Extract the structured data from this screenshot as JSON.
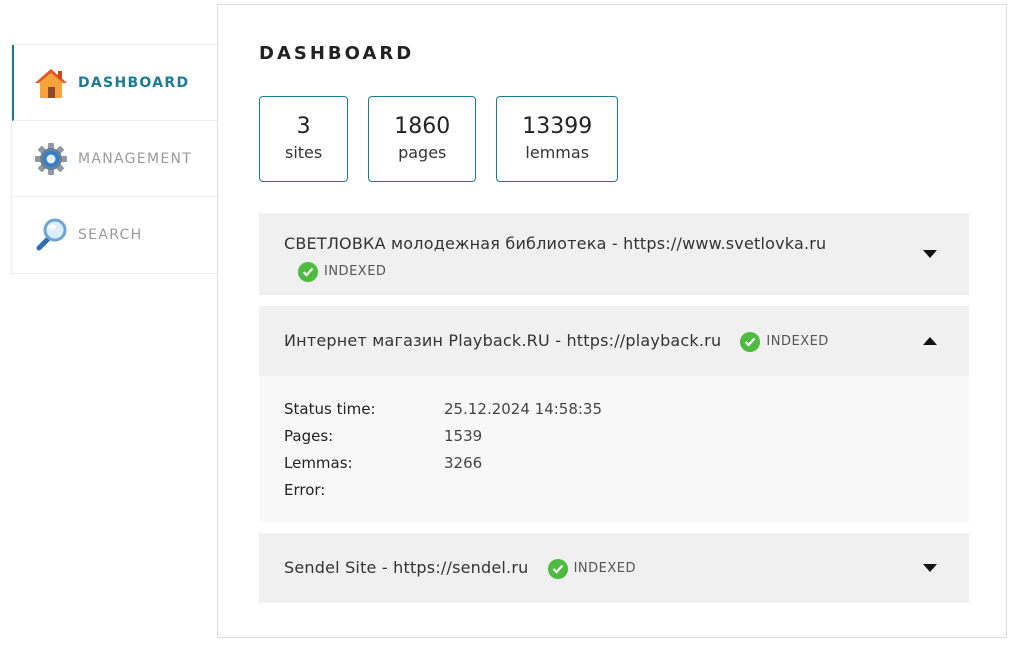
{
  "sidebar": {
    "items": [
      {
        "label": "DASHBOARD",
        "icon": "home-icon",
        "active": true
      },
      {
        "label": "MANAGEMENT",
        "icon": "gear-icon",
        "active": false
      },
      {
        "label": "SEARCH",
        "icon": "magnifier-icon",
        "active": false
      }
    ]
  },
  "main": {
    "title": "DASHBOARD",
    "stats": [
      {
        "value": "3",
        "label": "sites"
      },
      {
        "value": "1860",
        "label": "pages"
      },
      {
        "value": "13399",
        "label": "lemmas"
      }
    ],
    "sites": [
      {
        "name": "СВЕТЛОВКА молодежная библиотека - https://www.svetlovka.ru",
        "status": "INDEXED",
        "expanded": false
      },
      {
        "name": "Интернет магазин Playback.RU - https://playback.ru",
        "status": "INDEXED",
        "expanded": true,
        "details": {
          "status_time_label": "Status time:",
          "status_time": "25.12.2024 14:58:35",
          "pages_label": "Pages:",
          "pages": "1539",
          "lemmas_label": "Lemmas:",
          "lemmas": "3266",
          "error_label": "Error:",
          "error": ""
        }
      },
      {
        "name": "Sendel Site - https://sendel.ru",
        "status": "INDEXED",
        "expanded": false
      }
    ]
  },
  "colors": {
    "accent": "#1b7c93",
    "indexed": "#4cbb3f"
  }
}
